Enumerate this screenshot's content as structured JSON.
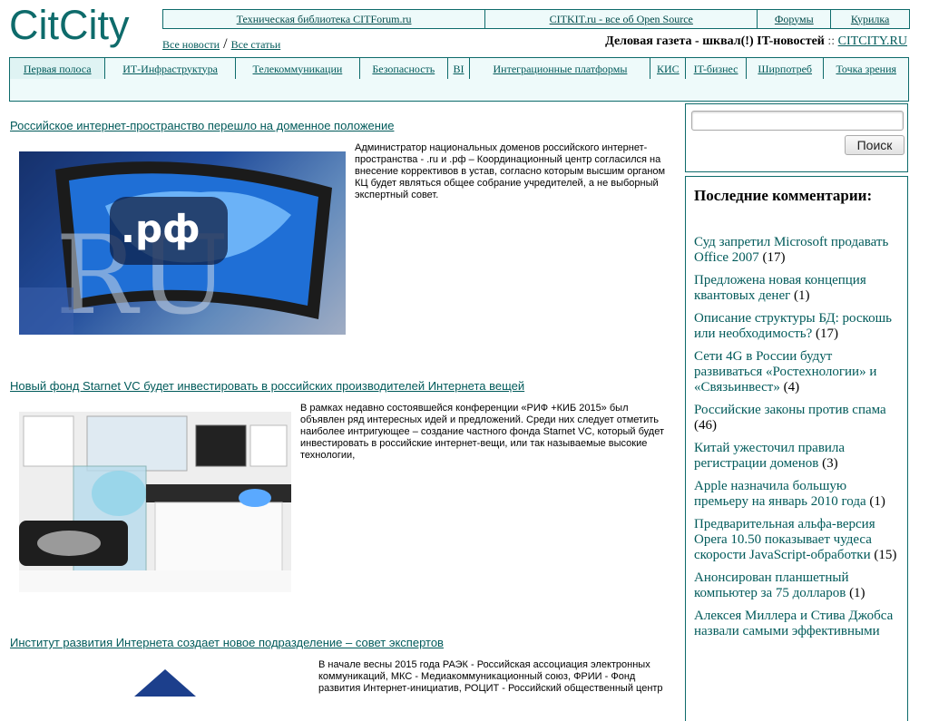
{
  "logo": "CitCity",
  "top_links": [
    {
      "label": "Техническая библиотека CITForum.ru"
    },
    {
      "label": "CITKIT.ru - все об Open Source"
    },
    {
      "label": "Форумы"
    },
    {
      "label": "Курилка"
    }
  ],
  "sub_links": {
    "news": "Все новости",
    "slash": "/",
    "articles": "Все статьи"
  },
  "tagline": {
    "text": "Деловая газета - шквал(!) IT-новостей",
    "sep": "::",
    "site": "CITCITY.RU"
  },
  "nav": [
    {
      "label": "Первая полоса"
    },
    {
      "label": "ИТ-Инфраструктура"
    },
    {
      "label": "Телекоммуникации"
    },
    {
      "label": "Безопасность"
    },
    {
      "label": "BI"
    },
    {
      "label": "Интеграционные платформы"
    },
    {
      "label": "КИС"
    },
    {
      "label": "IT-бизнес"
    },
    {
      "label": "Ширпотреб"
    },
    {
      "label": "Точка зрения"
    }
  ],
  "articles": [
    {
      "title": "Российское интернет-пространство перешло на доменное положение",
      "text": "Администратор национальных доменов российского интернет-пространства - .ru и .рф – Координационный центр согласился на внесение коррективов в устав, согласно которым высшим органом КЦ будет являться общее собрание учредителей, а не выборный экспертный совет.",
      "image_text": ".рф",
      "image_bg": "RU"
    },
    {
      "title": "Новый фонд Starnet VC будет инвестировать в российских производителей Интернета вещей",
      "text": "В рамках недавно состоявшейся конференции «РИФ +КИБ 2015» был объявлен ряд интересных идей и предложений. Среди них следует отметить наиболее интригующее – создание частного фонда Starnet VC, который будет инвестировать в российские интернет-вещи, или так называемые высокие технологии,"
    },
    {
      "title": "Институт развития Интернета создает новое подразделение – совет экспертов",
      "text": "В начале весны 2015 года РАЭК - Российская ассоциация электронных коммуникаций, МКС - Медиакоммуникационный союз, ФРИИ - Фонд развития Интернет-инициатив, РОЦИТ - Российский общественный центр"
    }
  ],
  "search": {
    "placeholder": "",
    "button": "Поиск"
  },
  "comments": {
    "title": "Последние комментарии:",
    "items": [
      {
        "text": "Суд запретил Microsoft продавать Office 2007",
        "count": "(17)"
      },
      {
        "text": "Предложена новая концепция квантовых денег",
        "count": "(1)"
      },
      {
        "text": "Описание структуры БД: роскошь или необходимость?",
        "count": "(17)"
      },
      {
        "text": "Сети 4G в России будут развиваться «Ростехнологии» и «Связьинвест»",
        "count": "(4)"
      },
      {
        "text": "Российские законы против спама",
        "count": "(46)"
      },
      {
        "text": "Китай ужесточил правила регистрации доменов",
        "count": "(3)"
      },
      {
        "text": "Apple назначила большую премьеру на январь 2010 года",
        "count": "(1)"
      },
      {
        "text": "Предварительная альфа-версия Opera 10.50 показывает чудеса скорости JavaScript-обработки",
        "count": "(15)"
      },
      {
        "text": "Анонсирован планшетный компьютер за 75 долларов",
        "count": "(1)"
      },
      {
        "text": "Алексея Миллера и Стива Джобса назвали самыми эффективными",
        "count": ""
      }
    ]
  },
  "colors": {
    "accent": "#0e6b6b",
    "link": "#005a5a",
    "panel": "#eefafa"
  }
}
